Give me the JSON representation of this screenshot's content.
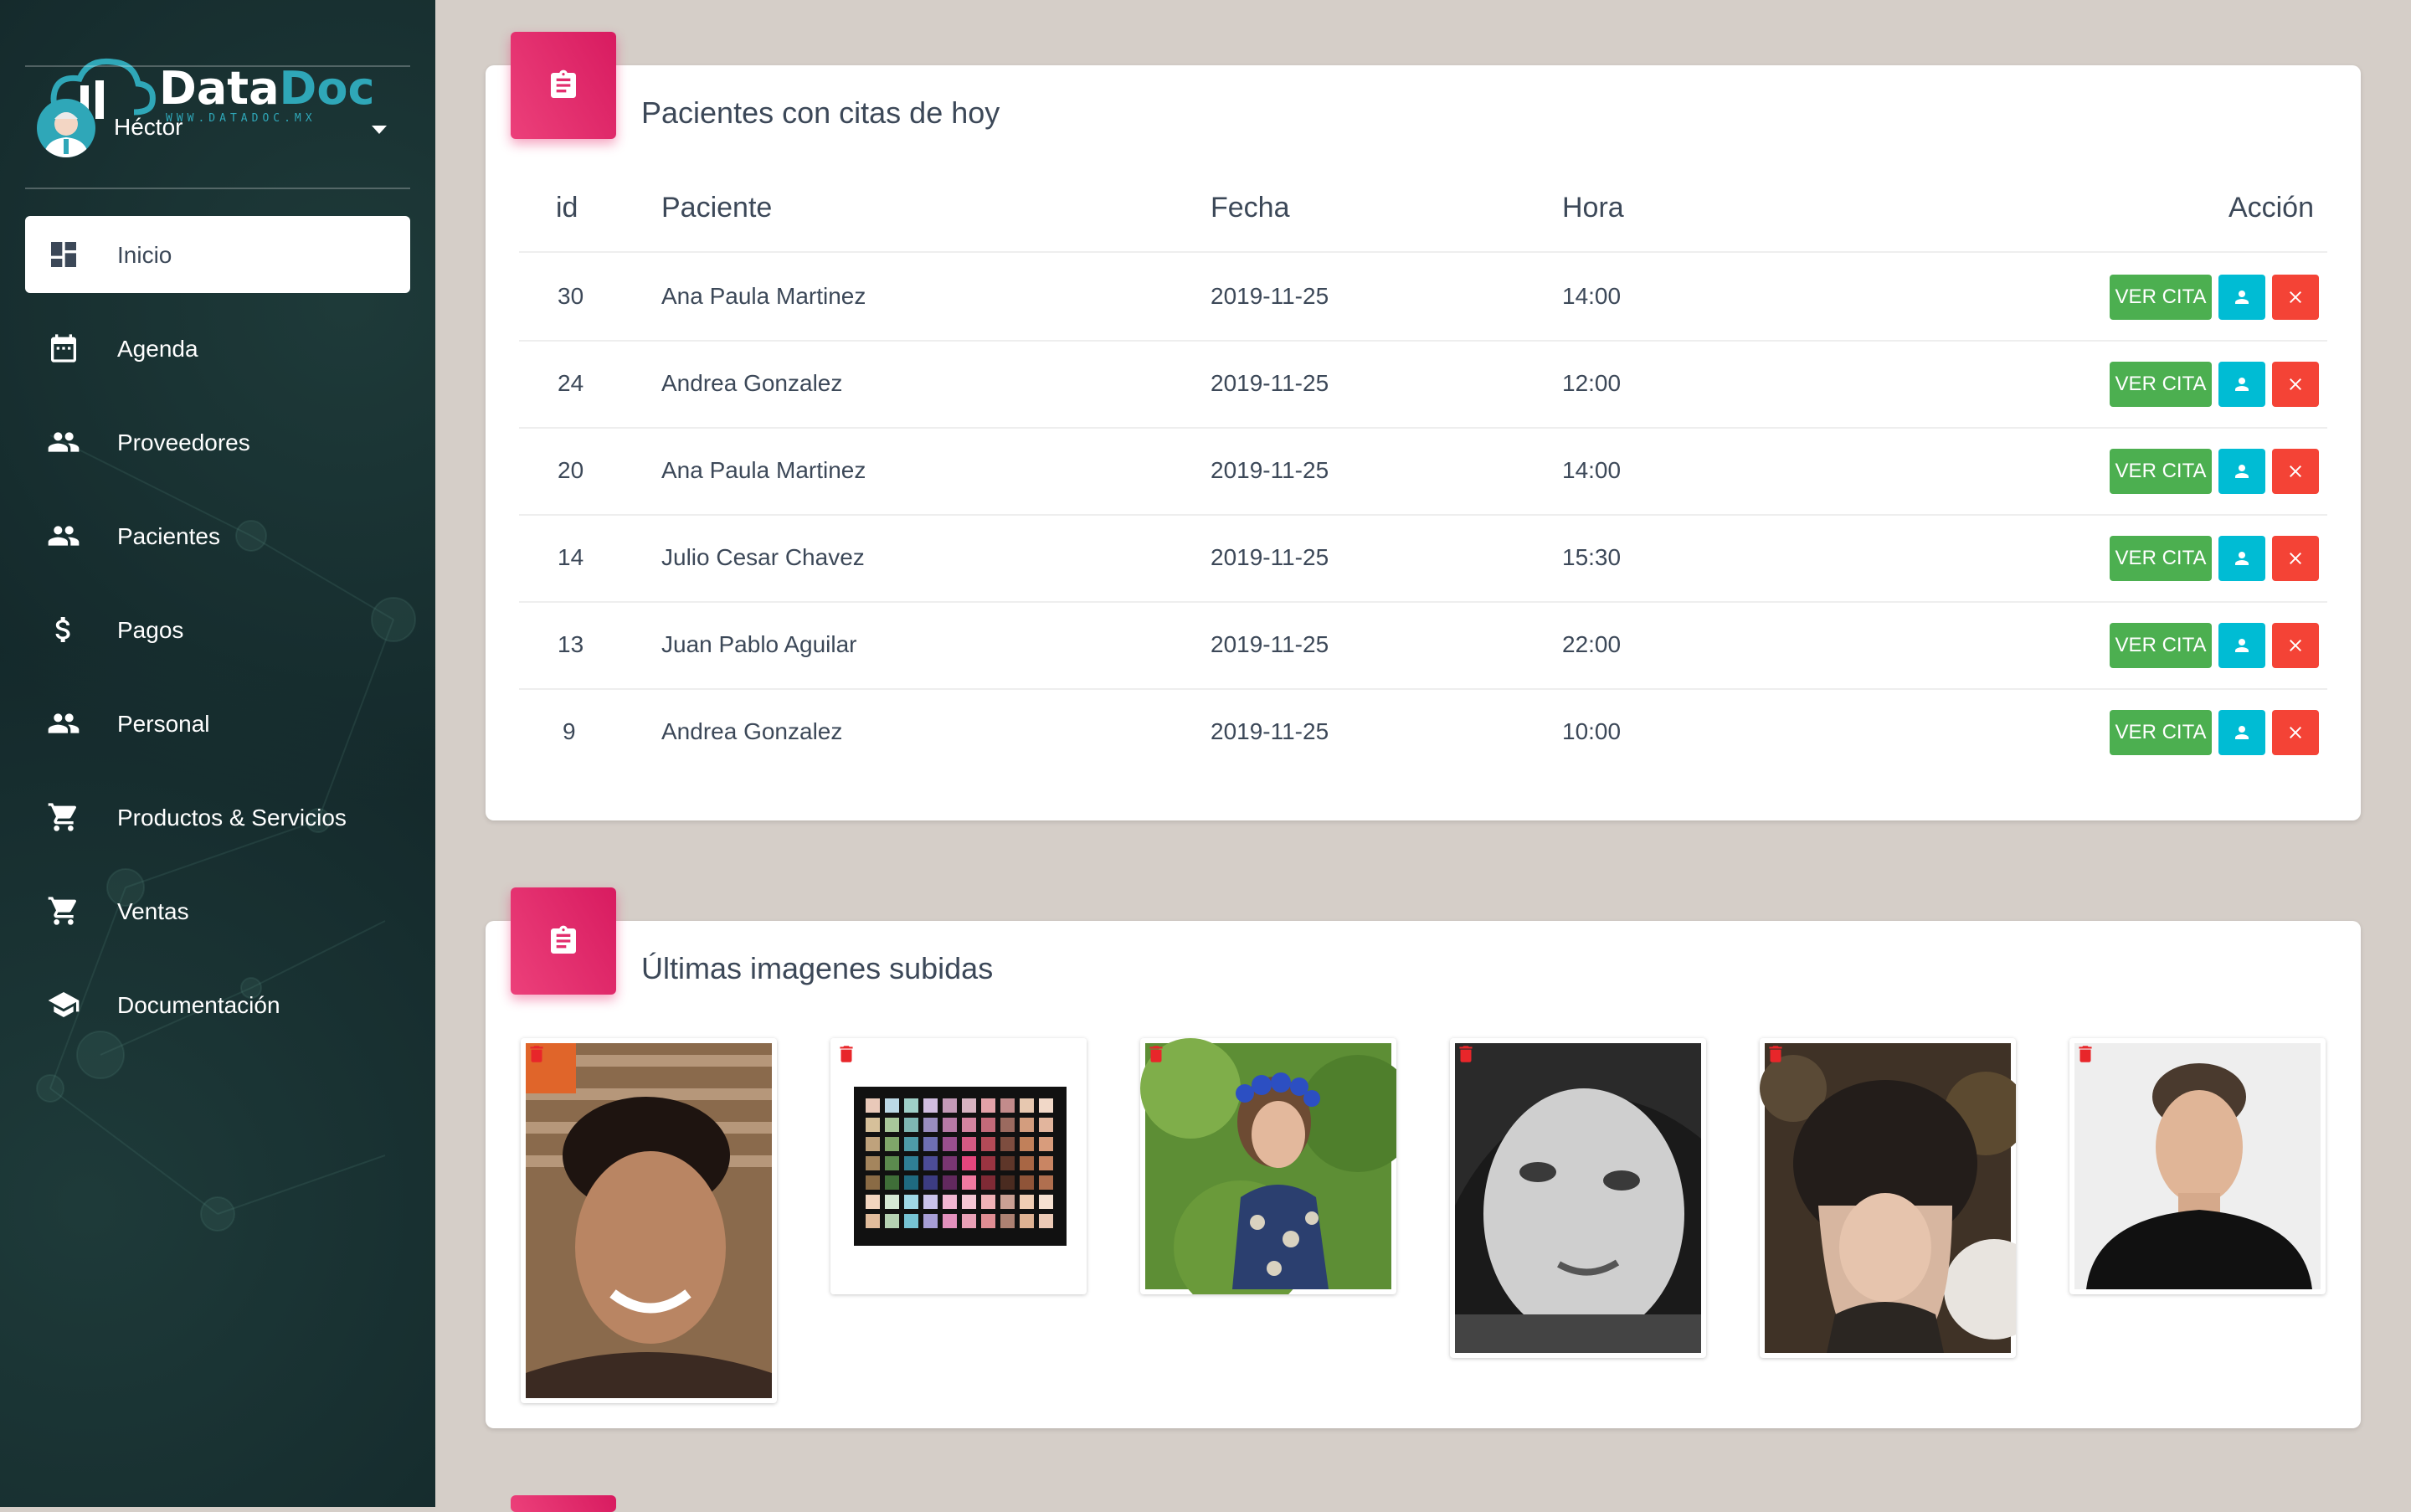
{
  "brand": {
    "name_part1": "Data",
    "name_part2": "Doc",
    "tagline": "WWW.DATADOC.MX"
  },
  "user": {
    "name": "Héctor"
  },
  "nav": [
    {
      "label": "Inicio",
      "icon": "dashboard-icon",
      "active": true
    },
    {
      "label": "Agenda",
      "icon": "calendar-icon"
    },
    {
      "label": "Proveedores",
      "icon": "people-icon"
    },
    {
      "label": "Pacientes",
      "icon": "people-icon"
    },
    {
      "label": "Pagos",
      "icon": "dollar-icon"
    },
    {
      "label": "Personal",
      "icon": "people-icon"
    },
    {
      "label": "Productos & Servicios",
      "icon": "cart-icon"
    },
    {
      "label": "Ventas",
      "icon": "cart-icon"
    },
    {
      "label": "Documentación",
      "icon": "school-icon"
    }
  ],
  "appointments": {
    "title": "Pacientes con citas de hoy",
    "columns": {
      "id": "id",
      "patient": "Paciente",
      "date": "Fecha",
      "time": "Hora",
      "action": "Acción"
    },
    "rows": [
      {
        "id": "30",
        "patient": "Ana Paula Martinez",
        "date": "2019-11-25",
        "time": "14:00"
      },
      {
        "id": "24",
        "patient": "Andrea Gonzalez",
        "date": "2019-11-25",
        "time": "12:00"
      },
      {
        "id": "20",
        "patient": "Ana Paula Martinez",
        "date": "2019-11-25",
        "time": "14:00"
      },
      {
        "id": "14",
        "patient": "Julio Cesar Chavez",
        "date": "2019-11-25",
        "time": "15:30"
      },
      {
        "id": "13",
        "patient": "Juan Pablo Aguilar",
        "date": "2019-11-25",
        "time": "22:00"
      },
      {
        "id": "9",
        "patient": "Andrea Gonzalez",
        "date": "2019-11-25",
        "time": "10:00"
      }
    ],
    "view_button_label": "VER CITA"
  },
  "gallery": {
    "title": "Últimas imagenes subidas",
    "images": [
      {
        "subject": "smiling man portrait",
        "delete_icon": "trash-icon"
      },
      {
        "subject": "eyeshadow palette",
        "delete_icon": "trash-icon"
      },
      {
        "subject": "woman with flower crown",
        "delete_icon": "trash-icon"
      },
      {
        "subject": "black and white woman portrait",
        "delete_icon": "trash-icon"
      },
      {
        "subject": "girl in knit hat",
        "delete_icon": "trash-icon"
      },
      {
        "subject": "man in black sweater",
        "delete_icon": "trash-icon"
      }
    ]
  },
  "colors": {
    "accent": "#e91e63",
    "success": "#4caf50",
    "info": "#00bcd4",
    "danger": "#f44336",
    "sidebar": "#14292b"
  }
}
